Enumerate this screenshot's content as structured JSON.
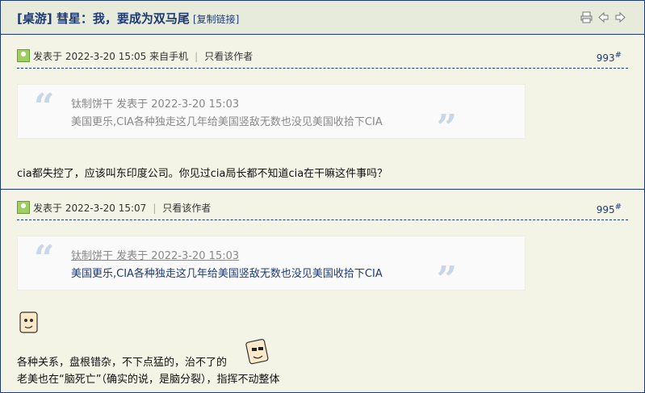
{
  "thread": {
    "title": "[桌游] 彗星：我，要成为双马尾",
    "copy_link": "[复制链接]"
  },
  "posts": [
    {
      "meta": "发表于 2022-3-20 15:05 来自手机",
      "only_author": "只看该作者",
      "floor": "993",
      "floor_mark": "#",
      "quote_head": "钛制饼干 发表于 2022-3-20 15:03",
      "quote_text": "美国更乐,CIA各种独走这几年给美国竖敌无数也没见美国收拾下CIA",
      "body": "cia都失控了，应该叫东印度公司。你见过cia局长都不知道cia在干嘛这件事吗？"
    },
    {
      "meta": "发表于 2022-3-20 15:07",
      "only_author": "只看该作者",
      "floor": "995",
      "floor_mark": "#",
      "quote_head": "钛制饼干 发表于 2022-3-20 15:03",
      "quote_text": "美国更乐,CIA各种独走这几年给美国竖敌无数也没见美国收拾下CIA",
      "body_line1": "各种关系，盘根错杂，不下点猛的，治不了的",
      "body_line2": "老美也在“脑死亡”（确实的说，是脑分裂），指挥不动整体"
    }
  ],
  "icons": {
    "print": "printer-icon",
    "prev": "arrow-left-icon",
    "next": "arrow-right-icon"
  },
  "colors": {
    "accent": "#1e3a72",
    "background": "#f3f4e6"
  }
}
